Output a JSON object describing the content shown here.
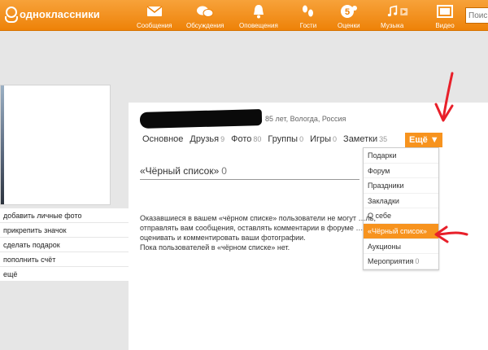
{
  "brand": {
    "name": "одноклассники"
  },
  "nav": [
    {
      "label": "Сообщения",
      "icon": "envelope-icon"
    },
    {
      "label": "Обсуждения",
      "icon": "chat-bubbles-icon"
    },
    {
      "label": "Оповещения",
      "icon": "bell-icon"
    },
    {
      "label": "Гости",
      "icon": "footprints-icon"
    },
    {
      "label": "Оценки",
      "icon": "rating-5-icon"
    },
    {
      "label": "Музыка",
      "icon": "music-note-icon"
    },
    {
      "label": "Видео",
      "icon": "video-icon"
    }
  ],
  "search": {
    "placeholder": "Поиск"
  },
  "profile": {
    "meta": "85 лет, Вологда, Россия"
  },
  "tabs": [
    {
      "label": "Основное",
      "count": ""
    },
    {
      "label": "Друзья",
      "count": "9"
    },
    {
      "label": "Фото",
      "count": "80"
    },
    {
      "label": "Группы",
      "count": "0"
    },
    {
      "label": "Игры",
      "count": "0"
    },
    {
      "label": "Заметки",
      "count": "35"
    }
  ],
  "more": {
    "label": "Ещё ▼"
  },
  "dropdown": [
    {
      "label": "Подарки",
      "count": ""
    },
    {
      "label": "Форум",
      "count": ""
    },
    {
      "label": "Праздники",
      "count": ""
    },
    {
      "label": "Закладки",
      "count": ""
    },
    {
      "label": "О себе",
      "count": ""
    },
    {
      "label": "«Чёрный список»",
      "count": ""
    },
    {
      "label": "Аукционы",
      "count": ""
    },
    {
      "label": "Мероприятия",
      "count": "0"
    }
  ],
  "leftmenu": [
    "добавить личные фото",
    "прикрепить значок",
    "сделать подарок",
    "пополнить счёт",
    "ещё"
  ],
  "section": {
    "title": "«Чёрный список»",
    "count": "0"
  },
  "body": {
    "line1": "Оказавшиеся в вашем «чёрном списке» пользователи не могут …ль,",
    "line2": "отправлять вам сообщения, оставлять комментарии в форуме …",
    "line3": "оценивать и комментировать ваши фотографии.",
    "line4": "Пока пользователей в «чёрном списке» нет."
  },
  "colors": {
    "orange": "#ee8208",
    "annotation_red": "#e8202a"
  }
}
